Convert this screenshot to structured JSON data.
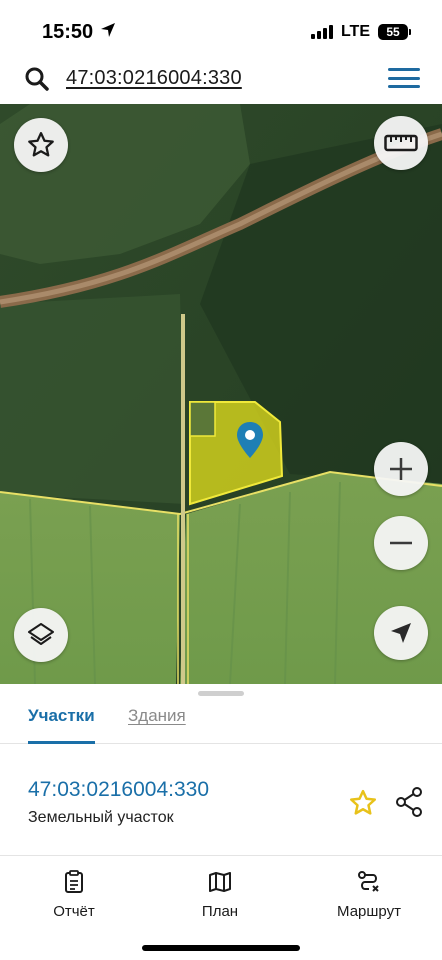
{
  "status_bar": {
    "time": "15:50",
    "network": "LTE",
    "battery": "55"
  },
  "search": {
    "query": "47:03:0216004:330",
    "icon": "search-icon",
    "menu_icon": "hamburger-menu-icon"
  },
  "map": {
    "buttons": {
      "favorite": "star-icon",
      "ruler": "ruler-icon",
      "zoom_in": "plus-icon",
      "zoom_out": "minus-icon",
      "layers": "layers-icon",
      "locate": "navigation-arrow-icon"
    },
    "parcel_highlight_color": "#e6e21c",
    "marker_color": "#1e7fb5"
  },
  "sheet": {
    "tabs": [
      {
        "label": "Участки",
        "active": true
      },
      {
        "label": "Здания",
        "active": false
      }
    ],
    "parcel": {
      "id": "47:03:0216004:330",
      "type": "Земельный участок",
      "star_color": "#e8c21a"
    }
  },
  "bottom_nav": [
    {
      "label": "Отчёт",
      "icon": "report-icon"
    },
    {
      "label": "План",
      "icon": "map-plan-icon"
    },
    {
      "label": "Маршрут",
      "icon": "route-icon"
    }
  ],
  "colors": {
    "accent": "#1a6fa8"
  }
}
